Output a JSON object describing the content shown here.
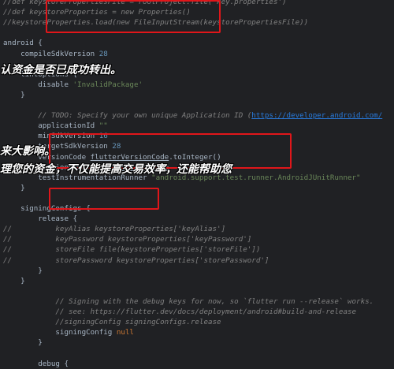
{
  "code": {
    "lines": [
      {
        "segments": [
          {
            "text": "//def keystorePropertiesFile = rootProject.file('key.properties')",
            "style": "comment"
          }
        ]
      },
      {
        "segments": [
          {
            "text": "//def keystoreProperties = new Properties()",
            "style": "comment"
          }
        ]
      },
      {
        "segments": [
          {
            "text": "//keystoreProperties.load(new FileInputStream(keystorePropertiesFile))",
            "style": "comment"
          }
        ]
      },
      {
        "segments": [
          {
            "text": "",
            "style": "plain"
          }
        ]
      },
      {
        "segments": [
          {
            "text": "android {",
            "style": "plain"
          }
        ]
      },
      {
        "segments": [
          {
            "text": "    compileSdkVersion ",
            "style": "plain"
          },
          {
            "text": "28",
            "style": "number"
          }
        ]
      },
      {
        "segments": [
          {
            "text": "",
            "style": "plain"
          }
        ]
      },
      {
        "segments": [
          {
            "text": "    lintOptions {",
            "style": "plain"
          }
        ]
      },
      {
        "segments": [
          {
            "text": "        disable ",
            "style": "plain"
          },
          {
            "text": "'InvalidPackage'",
            "style": "string"
          }
        ]
      },
      {
        "segments": [
          {
            "text": "    }",
            "style": "plain"
          }
        ]
      },
      {
        "segments": [
          {
            "text": "",
            "style": "plain"
          }
        ]
      },
      {
        "segments": [
          {
            "text": "        // TODO: Specify your own unique Application ID (",
            "style": "comment"
          },
          {
            "text": "https://developer.android.com/",
            "style": "link"
          }
        ]
      },
      {
        "segments": [
          {
            "text": "        applicationId ",
            "style": "plain"
          },
          {
            "text": "\"\"",
            "style": "string"
          }
        ]
      },
      {
        "segments": [
          {
            "text": "        minSdkVersion ",
            "style": "plain"
          },
          {
            "text": "16",
            "style": "number"
          }
        ]
      },
      {
        "segments": [
          {
            "text": "        targetSdkVersion ",
            "style": "plain"
          },
          {
            "text": "28",
            "style": "number"
          }
        ]
      },
      {
        "segments": [
          {
            "text": "        versionCode ",
            "style": "plain"
          },
          {
            "text": "flutterVersionCode",
            "style": "underline"
          },
          {
            "text": ".toInteger()",
            "style": "plain"
          }
        ]
      },
      {
        "segments": [
          {
            "text": "        versionName ",
            "style": "plain"
          },
          {
            "text": "flutterVersionName",
            "style": "underline"
          }
        ]
      },
      {
        "segments": [
          {
            "text": "        testInstrumentationRunner ",
            "style": "plain"
          },
          {
            "text": "\"android.support.test.runner.AndroidJUnitRunner\"",
            "style": "string"
          }
        ]
      },
      {
        "segments": [
          {
            "text": "    }",
            "style": "plain"
          }
        ]
      },
      {
        "segments": [
          {
            "text": "",
            "style": "plain"
          }
        ]
      },
      {
        "segments": [
          {
            "text": "    signingConfigs {",
            "style": "plain"
          }
        ]
      },
      {
        "segments": [
          {
            "text": "        release {",
            "style": "plain"
          }
        ]
      },
      {
        "segments": [
          {
            "text": "//          keyAlias keystoreProperties['keyAlias']",
            "style": "comment"
          }
        ]
      },
      {
        "segments": [
          {
            "text": "//          keyPassword keystoreProperties['keyPassword']",
            "style": "comment"
          }
        ]
      },
      {
        "segments": [
          {
            "text": "//          storeFile file(keystoreProperties['storeFile'])",
            "style": "comment"
          }
        ]
      },
      {
        "segments": [
          {
            "text": "//          storePassword keystoreProperties['storePassword']",
            "style": "comment"
          }
        ]
      },
      {
        "segments": [
          {
            "text": "        }",
            "style": "plain"
          }
        ]
      },
      {
        "segments": [
          {
            "text": "    }",
            "style": "plain"
          }
        ]
      },
      {
        "segments": [
          {
            "text": "",
            "style": "plain"
          }
        ]
      },
      {
        "segments": [
          {
            "text": "            // Signing with the debug keys for now, so `flutter run --release` works.",
            "style": "comment"
          }
        ]
      },
      {
        "segments": [
          {
            "text": "            // see: https://flutter.dev/docs/deployment/android#build-and-release",
            "style": "comment"
          }
        ]
      },
      {
        "segments": [
          {
            "text": "            //signingConfig signingConfigs.release",
            "style": "comment"
          }
        ]
      },
      {
        "segments": [
          {
            "text": "            signingConfig ",
            "style": "plain"
          },
          {
            "text": "null",
            "style": "keyword"
          }
        ]
      },
      {
        "segments": [
          {
            "text": "        }",
            "style": "plain"
          }
        ]
      },
      {
        "segments": [
          {
            "text": "",
            "style": "plain"
          }
        ]
      },
      {
        "segments": [
          {
            "text": "        debug {",
            "style": "plain"
          }
        ]
      }
    ]
  },
  "overlays": [
    {
      "text": "认资金是否已成功转出。"
    },
    {
      "text": "来大影响。"
    },
    {
      "text": "理您的资金，不仅能提高交易效率，还能帮助您"
    }
  ],
  "colors": {
    "background": "#202124",
    "annotation": "#e0161a",
    "comment": "#808080",
    "string": "#6a8759",
    "number": "#6897bb"
  }
}
